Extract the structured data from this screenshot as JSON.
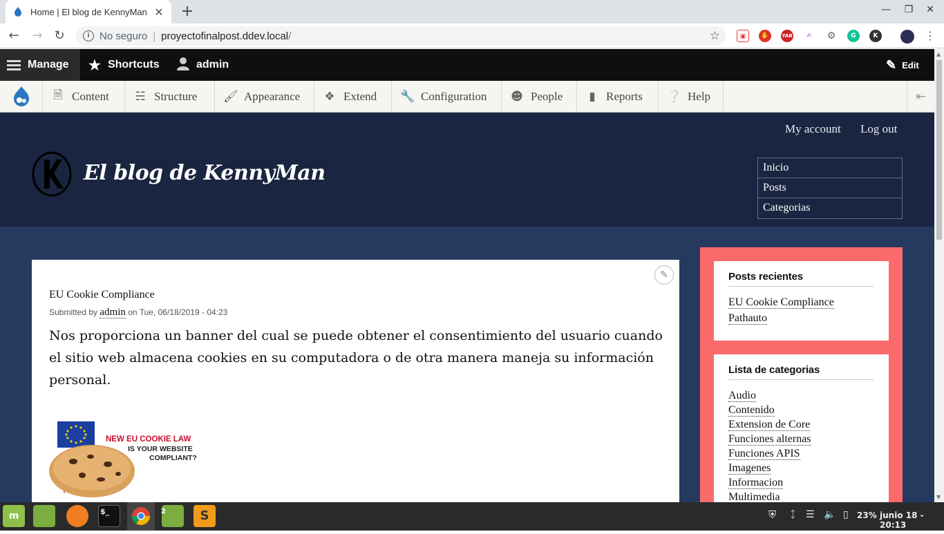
{
  "browser": {
    "tab_title": "Home | El blog de KennyMan",
    "tab_close": "✕",
    "new_tab": "+",
    "security_label": "No seguro",
    "url_host": "proyectofinalpost.ddev.local",
    "url_path": "/"
  },
  "toolbar": {
    "manage": "Manage",
    "shortcuts": "Shortcuts",
    "user": "admin",
    "edit": "Edit"
  },
  "admin_menu": [
    {
      "label": "Content",
      "icon": "file-icon"
    },
    {
      "label": "Structure",
      "icon": "sitemap-icon"
    },
    {
      "label": "Appearance",
      "icon": "brush-icon"
    },
    {
      "label": "Extend",
      "icon": "puzzle-icon"
    },
    {
      "label": "Configuration",
      "icon": "wrench-icon"
    },
    {
      "label": "People",
      "icon": "people-icon"
    },
    {
      "label": "Reports",
      "icon": "bar-chart-icon"
    },
    {
      "label": "Help",
      "icon": "help-icon"
    }
  ],
  "header": {
    "my_account": "My account",
    "log_out": "Log out",
    "site_name": "El blog de KennyMan",
    "nav": [
      "Inicio",
      "Posts",
      "Categorias"
    ]
  },
  "article": {
    "title": "EU Cookie Compliance",
    "submitted_by": "Submitted by",
    "author": "admin",
    "date": "on Tue, 06/18/2019 - 04:23",
    "body": "Nos proporciona un banner del cual se puede obtener el consentimiento del usuario cuando el sitio web almacena cookies en su computadora o de otra manera maneja su información personal.",
    "image_text": {
      "line1": "NEW EU COOKIE LAW",
      "line2": "IS YOUR WEBSITE",
      "line3": "COMPLIANT?"
    }
  },
  "sidebar": {
    "recent_title": "Posts recientes",
    "recent": [
      "EU Cookie Compliance",
      "Pathauto"
    ],
    "categories_title": "Lista de categorias",
    "categories": [
      "Audio",
      "Contenido",
      "Extension de Core",
      "Funciones alternas",
      "Funciones APIS",
      "Imagenes",
      "Informacion",
      "Multimedia"
    ]
  },
  "taskbar": {
    "terminal": "$_",
    "workspace_badge": "2",
    "sublime": "S",
    "battery": "23%",
    "clock": "junio 18 - 20:13"
  },
  "colors": {
    "header_bg": "#1a2541",
    "main_bg": "#263a60",
    "sidebar_bg": "#fb6b6b",
    "toolbar_bg": "#0f0f0f"
  }
}
